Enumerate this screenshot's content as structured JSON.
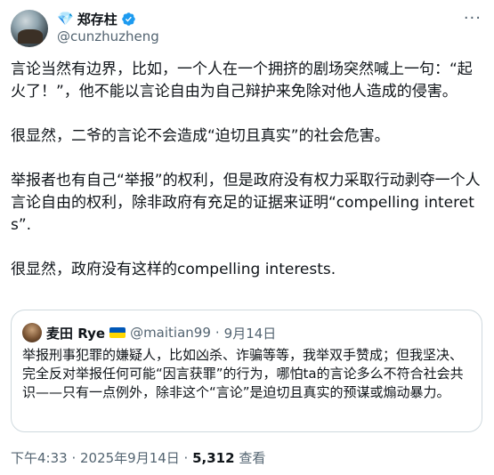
{
  "author": {
    "diamond_icon": "💎",
    "name": "郑存柱",
    "handle": "@cunzhuzheng"
  },
  "menu_icon": "···",
  "paragraphs": [
    "言论当然有边界，比如，一个人在一个拥挤的剧场突然喊上一句：“起火了！”，他不能以言论自由为自己辩护来免除对他人造成的侵害。",
    "很显然，二爷的言论不会造成“迫切且真实”的社会危害。",
    "举报者也有自己“举报”的权利，但是政府没有权力采取行动剥夺一个人言论自由的权利，除非政府有充足的证据来证明“compelling interets”.",
    "很显然，政府没有这样的compelling interests."
  ],
  "quote": {
    "name": "麦田 Rye",
    "handle": "@maitian99",
    "separator": "·",
    "date": "9月14日",
    "text": "举报刑事犯罪的嫌疑人，比如凶杀、诈骗等等，我举双手赞成；但我坚决、完全反对举报任何可能“因言获罪”的行为，哪怕ta的言论多么不符合社会共识——只有一点例外，除非这个“言论”是迫切且真实的预谋或煽动暴力。"
  },
  "footer": {
    "time": "下午4:33 · 2025年9月14日 · ",
    "views": "5,312",
    "views_label": " 查看"
  },
  "colors": {
    "accent": "#1d9bf0",
    "muted": "#536471",
    "border": "#cfd9de"
  }
}
